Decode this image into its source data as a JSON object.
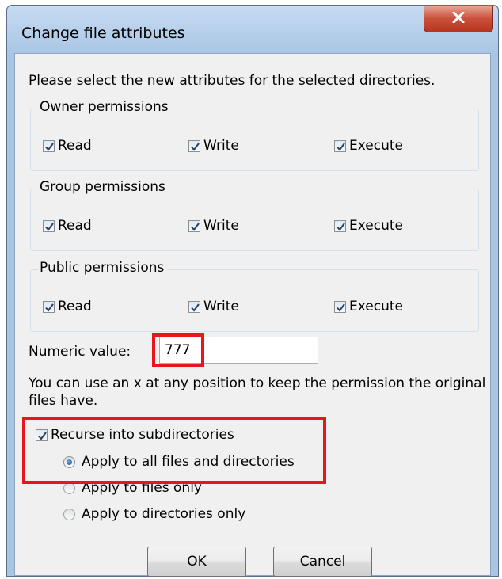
{
  "dialog": {
    "title": "Change file attributes",
    "close_icon": "close-x-icon"
  },
  "intro_text": "Please select the new attributes for the selected directories.",
  "groups": [
    {
      "title": "Owner permissions",
      "read": "Read",
      "write": "Write",
      "execute": "Execute",
      "read_checked": true,
      "write_checked": true,
      "execute_checked": true
    },
    {
      "title": "Group permissions",
      "read": "Read",
      "write": "Write",
      "execute": "Execute",
      "read_checked": true,
      "write_checked": true,
      "execute_checked": true
    },
    {
      "title": "Public permissions",
      "read": "Read",
      "write": "Write",
      "execute": "Execute",
      "read_checked": true,
      "write_checked": true,
      "execute_checked": true
    }
  ],
  "numeric": {
    "label": "Numeric value:",
    "value": "777"
  },
  "hint": "You can use an x at any position to keep the permission the original files have.",
  "recurse": {
    "label": "Recurse into subdirectories",
    "checked": true,
    "options": [
      {
        "label": "Apply to all files and directories",
        "selected": true
      },
      {
        "label": "Apply to files only",
        "selected": false
      },
      {
        "label": "Apply to directories only",
        "selected": false
      }
    ]
  },
  "buttons": {
    "ok": "OK",
    "cancel": "Cancel"
  },
  "colors": {
    "highlight": "#e8151c",
    "frame": "#a9c5e4",
    "close_button": "#c9503a"
  }
}
